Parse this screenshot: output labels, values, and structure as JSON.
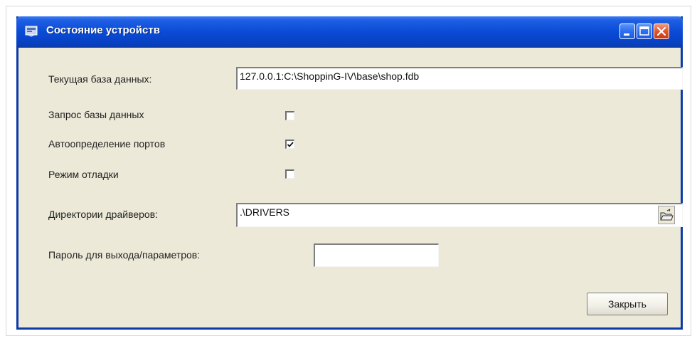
{
  "window": {
    "title": "Состояние устройств",
    "icon": "app-settings-icon",
    "controls": {
      "minimize_icon": "minimize-icon",
      "maximize_icon": "maximize-icon",
      "close_icon": "close-icon"
    }
  },
  "form": {
    "current_db": {
      "label": "Текущая база данных:",
      "value": "127.0.0.1:C:\\ShoppinG-IV\\base\\shop.fdb"
    },
    "db_query": {
      "label": "Запрос базы данных",
      "checked": false
    },
    "port_autodetect": {
      "label": "Автоопределение портов",
      "checked": true
    },
    "debug_mode": {
      "label": "Режим отладки",
      "checked": false
    },
    "drivers_dir": {
      "label": "Директории драйверов:",
      "value": ".\\DRIVERS",
      "browse_icon": "folder-browse-icon"
    },
    "exit_password": {
      "label": "Пароль для выхода/параметров:",
      "value": ""
    },
    "close_button": "Закрыть"
  },
  "colors": {
    "titlebar": "#0a4bd6",
    "window_bg": "#ece9d8",
    "close_control": "#e0532f"
  }
}
